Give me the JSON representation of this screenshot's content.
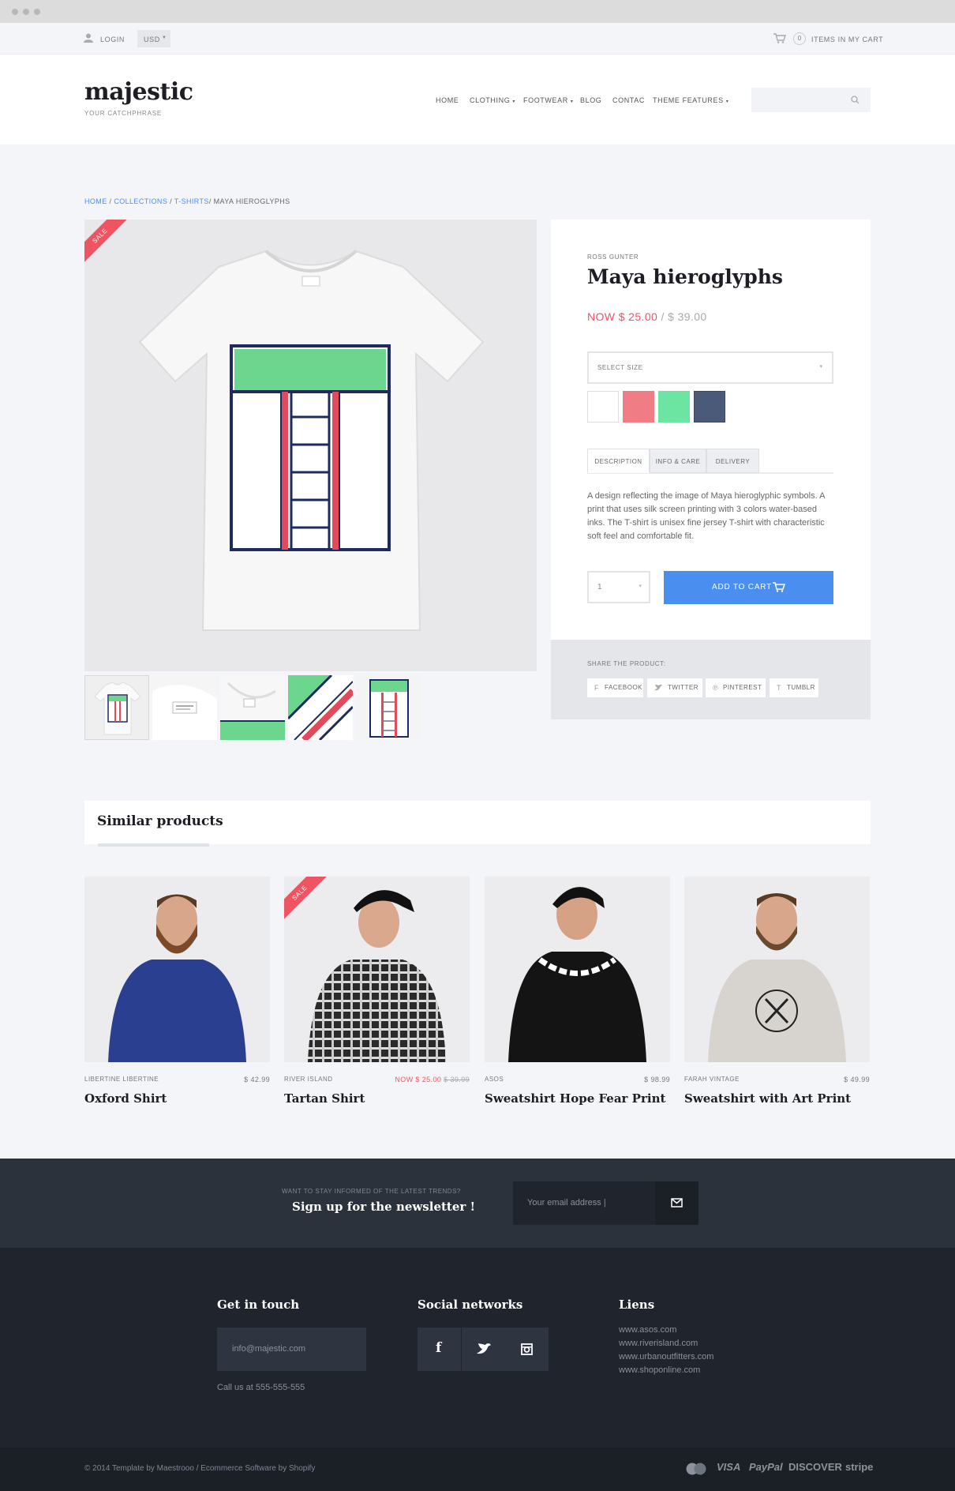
{
  "topbar": {
    "login": "LOGIN",
    "currency": "USD",
    "cart_count": "0",
    "cart_label": "ITEMS IN MY CART"
  },
  "header": {
    "logo": "majestic",
    "tagline": "YOUR CATCHPHRASE",
    "nav": [
      "HOME",
      "CLOTHING",
      "FOOTWEAR",
      "BLOG",
      "CONTAC",
      "THEME FEATURES"
    ]
  },
  "breadcrumb": {
    "home": "HOME",
    "collections": "COLLECTIONS",
    "tshirts": "T-SHIRTS",
    "current": "MAYA HIEROGLYPHS"
  },
  "product": {
    "sale_badge": "SALE",
    "brand": "ROSS GUNTER",
    "title": "Maya hieroglyphs",
    "price_now": "NOW $ 25.00",
    "price_sep": "/",
    "price_old": "$ 39.00",
    "size_placeholder": "SELECT SIZE",
    "colors": [
      "#ffffff",
      "#f07c86",
      "#6ce4a2",
      "#4a5a78"
    ],
    "tabs": [
      "DESCRIPTION",
      "INFO & CARE",
      "DELIVERY"
    ],
    "description": "A design reflecting the image of Maya hieroglyphic symbols. A print that uses silk screen printing with 3 colors water-based inks. The T-shirt is unisex fine jersey T-shirt with characteristic soft feel and comfortable fit.",
    "quantity": "1",
    "add_to_cart": "ADD TO CART",
    "share_label": "SHARE THE PRODUCT:",
    "share": [
      "FACEBOOK",
      "TWITTER",
      "PINTEREST",
      "TUMBLR"
    ]
  },
  "similar": {
    "heading": "Similar products",
    "items": [
      {
        "brand": "LIBERTINE LIBERTINE",
        "price": "$ 42.99",
        "name": "Oxford Shirt",
        "shirt": "#2a3f8f",
        "sale": false
      },
      {
        "brand": "RIVER ISLAND",
        "price_now": "NOW $ 25.00",
        "price_old": "$ 39.99",
        "name": "Tartan Shirt",
        "shirt": "#2b2b2b",
        "sale": true,
        "sale_badge": "SALE"
      },
      {
        "brand": "ASOS",
        "price": "$ 98.99",
        "name": "Sweatshirt Hope Fear Print",
        "shirt": "#141414",
        "sale": false
      },
      {
        "brand": "FARAH VINTAGE",
        "price": "$ 49.99",
        "name": "Sweatshirt with Art Print",
        "shirt": "#d7d4cf",
        "sale": false
      }
    ]
  },
  "newsletter": {
    "kicker": "WANT TO STAY INFORMED OF THE LATEST TRENDS?",
    "title": "Sign up for the newsletter !",
    "placeholder": "Your email address |"
  },
  "footer": {
    "contact_title": "Get in touch",
    "email": "info@majestic.com",
    "phone": "Call us at 555-555-555",
    "social_title": "Social networks",
    "links_title": "Liens",
    "links": [
      "www.asos.com",
      "www.riverisland.com",
      "www.urbanoutfitters.com",
      "www.shoponline.com"
    ],
    "copyright": "© 2014 Template by Maestrooo / Ecommerce Software by Shopify",
    "payments": [
      "VISA",
      "PayPal",
      "DISCOVER",
      "stripe"
    ]
  }
}
